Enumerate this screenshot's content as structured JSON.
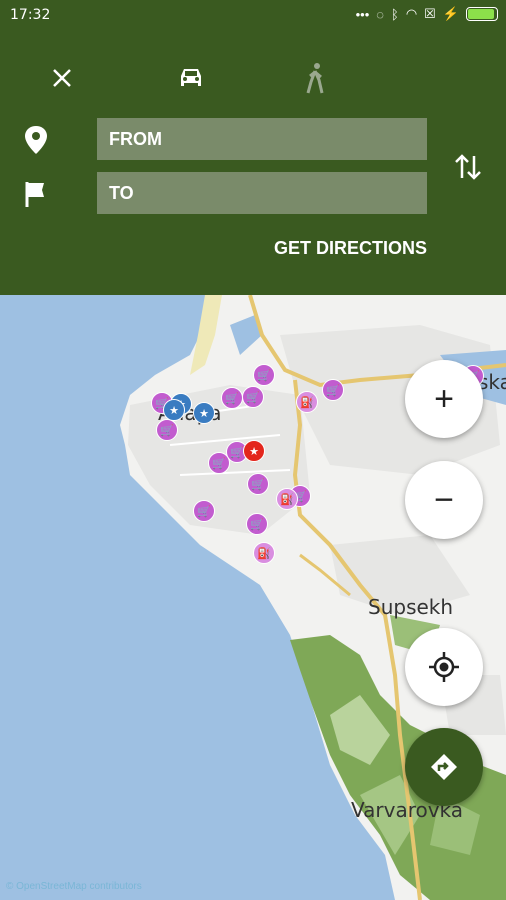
{
  "status_bar": {
    "time": "17:32"
  },
  "directions": {
    "from_placeholder": "FROM",
    "to_placeholder": "TO",
    "get_directions_label": "GET DIRECTIONS"
  },
  "map": {
    "places": [
      "Anapa",
      "Supsekh",
      "Varvarovka",
      "ska"
    ],
    "copyright": "© OpenStreetMap contributors"
  },
  "controls": {
    "zoom_in": "+",
    "zoom_out": "−"
  },
  "colors": {
    "header": "#3a5a20",
    "field": "#7a8b6a",
    "water": "#9ec0e2",
    "land": "#f2f2f0",
    "forest": "#7fa857",
    "shop_pin": "#c25ccf"
  }
}
